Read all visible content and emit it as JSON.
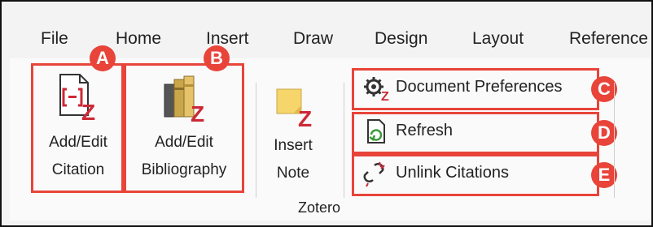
{
  "menu_tabs": [
    "File",
    "Home",
    "Insert",
    "Draw",
    "Design",
    "Layout",
    "Reference"
  ],
  "buttons": {
    "add_edit_citation": {
      "line1": "Add/Edit",
      "line2": "Citation"
    },
    "add_edit_bibliography": {
      "line1": "Add/Edit",
      "line2": "Bibliography"
    },
    "insert_note": {
      "line1": "Insert",
      "line2": "Note"
    },
    "document_preferences": "Document Preferences",
    "refresh": "Refresh",
    "unlink_citations": "Unlink Citations"
  },
  "group_label": "Zotero",
  "badges": {
    "a": "A",
    "b": "B",
    "c": "C",
    "d": "D",
    "e": "E"
  },
  "colors": {
    "highlight": "#e8443a",
    "zotero_red": "#cc2936",
    "refresh_green": "#3a9a3a"
  },
  "icons": [
    "citation-icon",
    "bibliography-icon",
    "insert-note-icon",
    "gear-icon",
    "refresh-icon",
    "unlink-icon"
  ]
}
